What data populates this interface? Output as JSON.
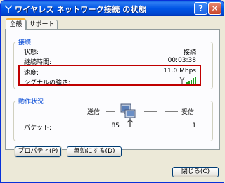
{
  "window": {
    "title": "ワイヤレス ネットワーク接続 の状態"
  },
  "titlebar": {
    "help_glyph": "?",
    "close_glyph": "✕"
  },
  "tabs": [
    {
      "label": "全般"
    },
    {
      "label": "サポート"
    }
  ],
  "connection": {
    "title": "接続",
    "status_label": "状態:",
    "status_value": "接続",
    "duration_label": "継続時間:",
    "duration_value": "00:03:38",
    "speed_label": "速度:",
    "speed_value": "11.0 Mbps",
    "signal_label": "シグナルの強さ:",
    "signal_bars": 5
  },
  "activity": {
    "title": "動作状況",
    "sent_label": "送信",
    "received_label": "受信",
    "packets_label": "パケット:",
    "packets_sent": "85",
    "packets_received": "1"
  },
  "buttons": {
    "properties": "プロパティ(P)",
    "disable": "無効にする(D)",
    "close": "閉じる(C)"
  },
  "colors": {
    "titlebar": "#0055e5",
    "group_title": "#0046d5",
    "highlight": "#c00000",
    "signal": "#1f9e1f"
  }
}
